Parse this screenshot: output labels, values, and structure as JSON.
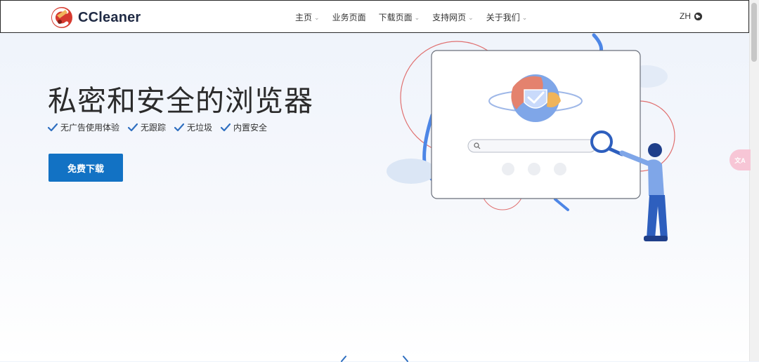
{
  "header": {
    "brand": "CCleaner",
    "nav": [
      {
        "label": "主页",
        "has_dropdown": true
      },
      {
        "label": "业务页面",
        "has_dropdown": false
      },
      {
        "label": "下载页面",
        "has_dropdown": true
      },
      {
        "label": "支持网页",
        "has_dropdown": true
      },
      {
        "label": "关于我们",
        "has_dropdown": true
      }
    ],
    "lang": "ZH",
    "lang_icon": "globe-icon"
  },
  "hero": {
    "title": "私密和安全的浏览器",
    "features": [
      "无广告使用体验",
      "无跟踪",
      "无垃圾",
      "内置安全"
    ],
    "download_label": "免费下载"
  },
  "colors": {
    "accent": "#1272c4",
    "check": "#2f6fc0",
    "brand_red": "#d63a2f"
  }
}
